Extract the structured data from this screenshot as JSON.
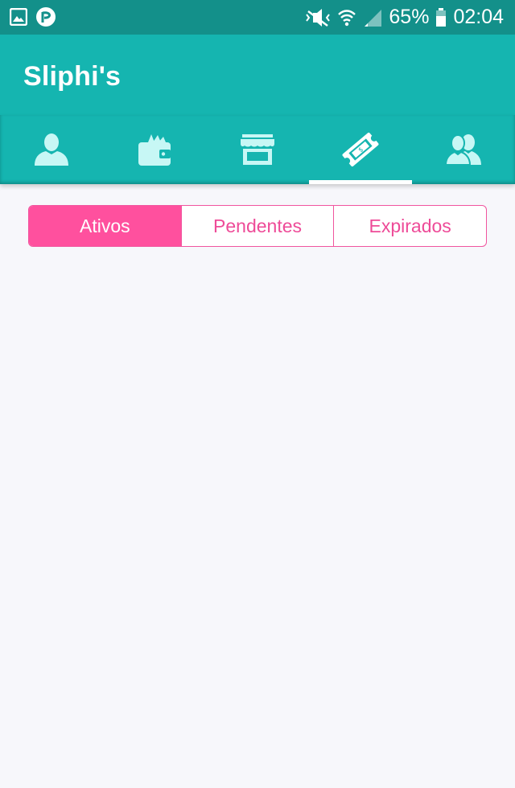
{
  "status_bar": {
    "battery": "65%",
    "time": "02:04",
    "icons": [
      "gallery-icon",
      "app-badge-icon",
      "mute-icon",
      "wifi-icon",
      "signal-icon",
      "battery-icon"
    ]
  },
  "app_bar": {
    "title": "Sliphi's"
  },
  "nav_tabs": [
    {
      "icon": "user-icon",
      "selected": false
    },
    {
      "icon": "wallet-icon",
      "selected": false
    },
    {
      "icon": "store-icon",
      "selected": false
    },
    {
      "icon": "coupon-ticket-icon",
      "selected": true
    },
    {
      "icon": "group-icon",
      "selected": false
    }
  ],
  "filter": {
    "options": [
      "Ativos",
      "Pendentes",
      "Expirados"
    ],
    "selected": "Ativos"
  },
  "colors": {
    "status_bar": "#13908a",
    "primary": "#15b5b0",
    "icon_tint": "#c7f7f5",
    "accent": "#ff509e",
    "background": "#f7f7fb"
  }
}
